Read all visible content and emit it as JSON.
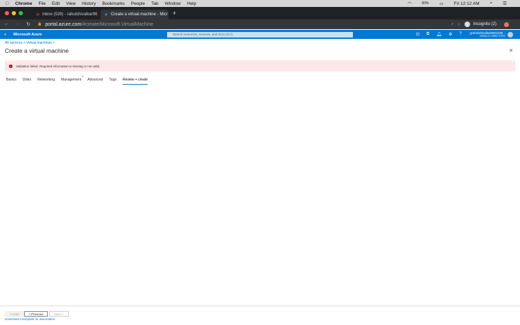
{
  "menubar": {
    "items": [
      "Chrome",
      "File",
      "Edit",
      "View",
      "History",
      "Bookmarks",
      "People",
      "Tab",
      "Window",
      "Help"
    ],
    "battery": "83%",
    "clock": "Fri 12:12 AM"
  },
  "browser": {
    "tabs": [
      {
        "title": "Inbox (529) - rahulshivalkar96"
      },
      {
        "title": "Create a virtual machine - Micr"
      }
    ],
    "url_host": "portal.azure.com",
    "url_path": "/#create/Microsoft.VirtualMachine",
    "incognito": "Incognito (2)"
  },
  "azure": {
    "brand": "Microsoft Azure",
    "search_placeholder": "Search resources, services, and docs (G+/)",
    "user": "rahulshivalkar9661196...",
    "directory": "DEFAULT DIRECTORY",
    "accent": "#0078d4"
  },
  "breadcrumb": [
    "All services",
    "Virtual machines"
  ],
  "page_title": "Create a virtual machine",
  "validation": "Validation failed. Required information is missing or not valid.",
  "tabs": [
    {
      "label": "Basics"
    },
    {
      "label": "Disks"
    },
    {
      "label": "Networking"
    },
    {
      "label": "Management",
      "error": true
    },
    {
      "label": "Advanced"
    },
    {
      "label": "Tags"
    },
    {
      "label": "Review + create",
      "selected": true
    }
  ],
  "footer": {
    "create": "Create",
    "previous": "< Previous",
    "next": "Next >",
    "template_link": "Download a template for automation"
  }
}
